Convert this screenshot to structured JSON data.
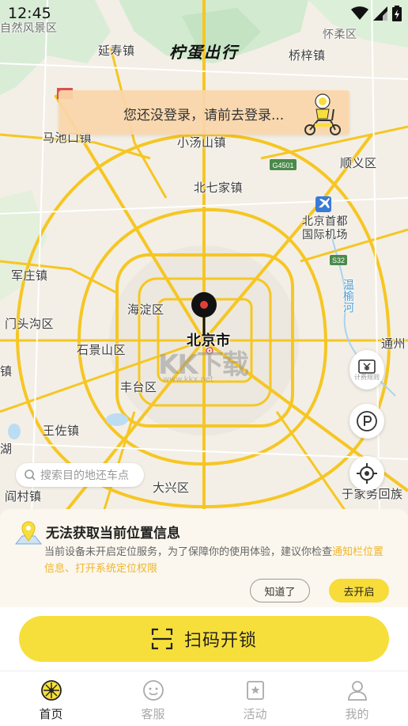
{
  "status_bar": {
    "time": "12:45"
  },
  "app": {
    "logo_text": "柠蛋出行"
  },
  "login_banner": {
    "text": "您还没登录，请前去登录..."
  },
  "map": {
    "labels": {
      "scenic": "自然风景区",
      "yanshou": "延寿镇",
      "qiaozi": "桥梓镇",
      "huairou": "怀柔区",
      "machikou": "马池口镇",
      "xiaotangshan": "小汤山镇",
      "shunyi": "顺义区",
      "beiqijia": "北七家镇",
      "airport": "北京首都\n国际机场",
      "junzhuang": "军庄镇",
      "haidian": "海淀区",
      "wenyu": "温榆河",
      "mentougou": "门头沟区",
      "beijing": "北京市",
      "shijingshan": "石景山区",
      "tongzhou": "通州",
      "zhen": "镇",
      "fengtai": "丰台区",
      "wangzuo": "王佐镇",
      "hu": "湖",
      "yancun": "阎村镇",
      "daxing": "大兴区",
      "yufa": "于家务回族"
    },
    "road_badges": {
      "g4501": "G4501",
      "s32": "S32"
    },
    "watermark": "KK下载",
    "watermark_url": "www.kkx.net"
  },
  "controls": {
    "billing_label": "计费规则"
  },
  "search": {
    "placeholder": "搜索目的地还车点"
  },
  "location_panel": {
    "title": "无法获取当前位置信息",
    "desc_prefix": "当前设备未开启定位服务，为了保障你的使用体验，建议你检查",
    "desc_link": "通知栏位置信息、打开系统定位权限",
    "dismiss_label": "知道了",
    "enable_label": "去开启"
  },
  "scan": {
    "label": "扫码开锁"
  },
  "tabs": [
    {
      "label": "首页",
      "icon": "lemon-icon",
      "active": true
    },
    {
      "label": "客服",
      "icon": "service-icon",
      "active": false
    },
    {
      "label": "活动",
      "icon": "activity-icon",
      "active": false
    },
    {
      "label": "我的",
      "icon": "profile-icon",
      "active": false
    }
  ],
  "colors": {
    "accent": "#f7df3b",
    "link": "#f0b52a",
    "road": "#f6c623"
  }
}
